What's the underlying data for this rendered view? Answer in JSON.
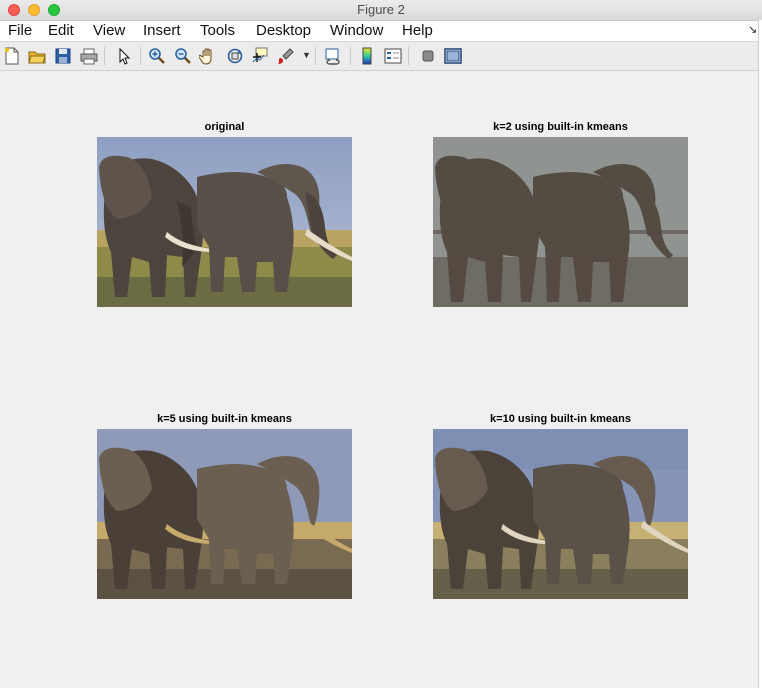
{
  "window": {
    "title": "Figure 2"
  },
  "menu": [
    "File",
    "Edit",
    "View",
    "Insert",
    "Tools",
    "Desktop",
    "Window",
    "Help"
  ],
  "toolbar_icons": [
    "new-figure-icon",
    "open-file-icon",
    "save-icon",
    "print-icon",
    "pointer-icon",
    "zoom-in-icon",
    "zoom-out-icon",
    "pan-icon",
    "rotate-3d-icon",
    "data-cursor-icon",
    "brush-icon",
    "dropdown-arrow-icon",
    "link-plot-icon",
    "colorbar-icon",
    "legend-icon",
    "hide-plot-tools-icon",
    "show-plot-tools-icon"
  ],
  "subplots": [
    {
      "title": "original",
      "variant": "original"
    },
    {
      "title": "k=2 using built-in kmeans",
      "variant": "k2"
    },
    {
      "title": "k=5 using built-in kmeans",
      "variant": "k5"
    },
    {
      "title": "k=10 using built-in kmeans",
      "variant": "k10"
    }
  ],
  "colors": {
    "window_bg": "#f0f0f0",
    "close": "#fc5f57",
    "minimize": "#fdbc2e",
    "maximize": "#28c840"
  }
}
